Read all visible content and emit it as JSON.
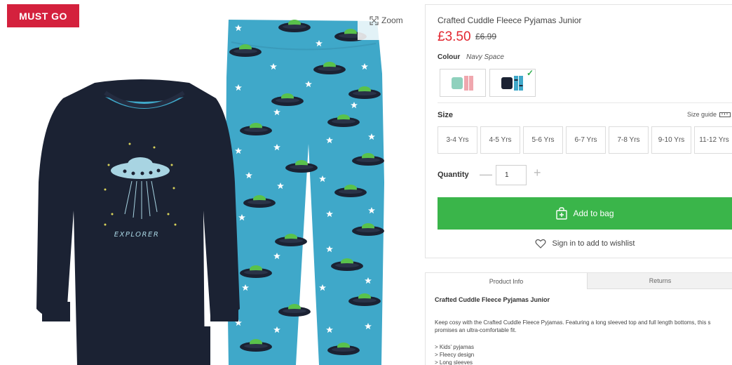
{
  "badge": "MUST GO",
  "zoom_label": "Zoom",
  "product": {
    "title": "Crafted Cuddle Fleece Pyjamas Junior",
    "price": "£3.50",
    "old_price": "£6.99"
  },
  "colour": {
    "label": "Colour",
    "value": "Navy Space"
  },
  "size": {
    "label": "Size",
    "guide": "Size guide",
    "options": [
      "3-4 Yrs",
      "4-5 Yrs",
      "5-6 Yrs",
      "6-7 Yrs",
      "7-8 Yrs",
      "9-10 Yrs",
      "11-12 Yrs"
    ]
  },
  "quantity": {
    "label": "Quantity",
    "value": "1",
    "minus": "—",
    "plus": "+"
  },
  "add_to_bag": "Add to bag",
  "wishlist": "Sign in to add to wishlist",
  "tabs": [
    "Product Info",
    "Returns"
  ],
  "info": {
    "title": "Crafted Cuddle Fleece Pyjamas Junior",
    "desc_line1": "Keep cosy with the Crafted Cuddle Fleece Pyjamas. Featuring a long sleeved top and full length bottoms, this s",
    "desc_line2": "promises an ultra-comfortable fit.",
    "bullets": [
      "> Kids' pyjamas",
      "> Fleecy design",
      "> Long sleeves"
    ]
  },
  "graphic_text": "EXPLORER",
  "colors": {
    "badge": "#d4213d",
    "price": "#e2262f",
    "add_button": "#3ab54a",
    "navy": "#1b2233",
    "teal": "#3fa8c9"
  }
}
